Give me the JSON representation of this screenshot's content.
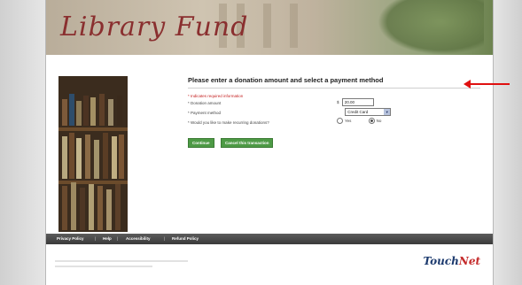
{
  "banner": {
    "title": "Library Fund"
  },
  "form": {
    "heading": "Please enter a donation amount and select a payment method",
    "required_note": "* Indicates required information",
    "donation_label": "* Donation amount",
    "currency_symbol": "$",
    "donation_value": "20.00",
    "payment_label": "* Payment method",
    "payment_value": "Credit Card",
    "recurring_label": "* Would you like to make recurring donations?",
    "yes_label": "Yes",
    "no_label": "No",
    "recurring_selected": "No",
    "continue_label": "Continue",
    "cancel_label": "Cancel this transaction"
  },
  "footer": {
    "links": [
      "Privacy Policy",
      "Help",
      "Accessibility",
      "Refund Policy"
    ]
  },
  "brand": {
    "touchnet_a": "Touch",
    "touchnet_b": "Net"
  },
  "colors": {
    "accent": "#e01010",
    "button": "#4d9a45",
    "required": "#c41e1e"
  }
}
